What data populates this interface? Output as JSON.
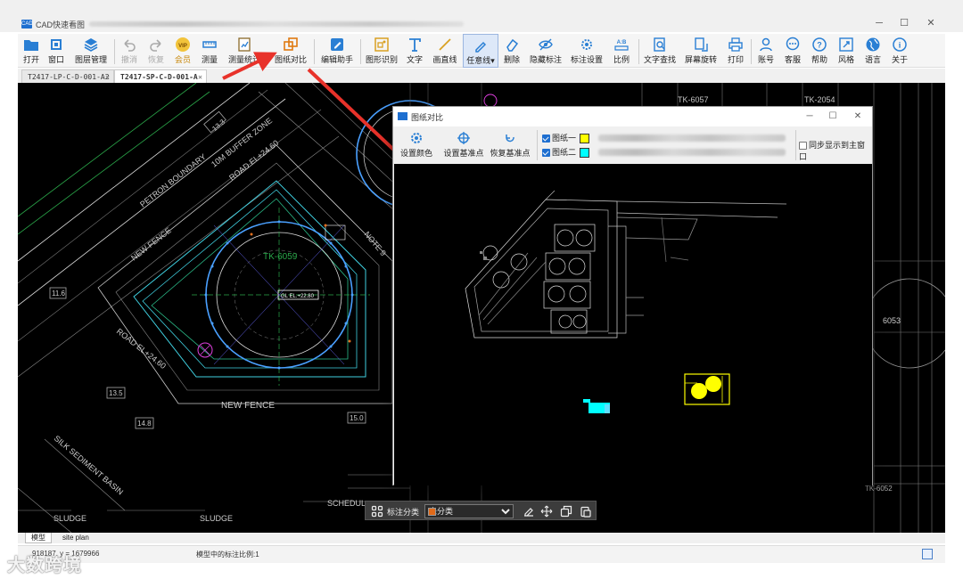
{
  "window": {
    "app_title": "CAD快速看图",
    "icon_text": "CAD",
    "minimize": "─",
    "maximize": "☐",
    "close": "✕"
  },
  "toolbar": [
    {
      "label": "打开",
      "icon": "open-folder-icon",
      "color": "#2a7fd4"
    },
    {
      "label": "窗口",
      "icon": "window-icon",
      "color": "#2a7fd4"
    },
    {
      "label": "图层管理",
      "icon": "layers-icon",
      "color": "#2a7fd4"
    },
    {
      "label": "撤消",
      "icon": "undo-icon",
      "disabled": true
    },
    {
      "label": "恢复",
      "icon": "redo-icon",
      "disabled": true
    },
    {
      "label": "会员",
      "icon": "vip-icon",
      "color": "#d9a021"
    },
    {
      "label": "测量",
      "icon": "measure-icon",
      "color": "#2a7fd4"
    },
    {
      "label": "测量统计",
      "icon": "measure-stats-icon",
      "color": "#8a6a2a"
    },
    {
      "label": "图纸对比",
      "icon": "drawing-compare-icon",
      "color": "#e07a10"
    },
    {
      "label": "编辑助手",
      "icon": "edit-assistant-icon",
      "color": "#2a7fd4"
    },
    {
      "label": "图形识别",
      "icon": "shape-recognition-icon",
      "color": "#d9a021"
    },
    {
      "label": "文字",
      "icon": "text-icon",
      "color": "#2a7fd4"
    },
    {
      "label": "画直线",
      "icon": "draw-line-icon",
      "color": "#d9a021"
    },
    {
      "label": "任意线",
      "icon": "freehand-line-icon",
      "color": "#2a7fd4"
    },
    {
      "label": "删除",
      "icon": "eraser-icon",
      "color": "#2a7fd4"
    },
    {
      "label": "隐藏标注",
      "icon": "hide-annotation-icon",
      "color": "#2a7fd4"
    },
    {
      "label": "标注设置",
      "icon": "annotation-settings-icon",
      "color": "#2a7fd4"
    },
    {
      "label": "比例",
      "icon": "scale-icon",
      "color": "#2a7fd4"
    },
    {
      "label": "文字查找",
      "icon": "text-search-icon",
      "color": "#2a7fd4"
    },
    {
      "label": "屏幕旋转",
      "icon": "screen-rotate-icon",
      "color": "#2a7fd4"
    },
    {
      "label": "打印",
      "icon": "print-icon",
      "color": "#2a7fd4"
    },
    {
      "label": "账号",
      "icon": "account-icon",
      "color": "#2a7fd4"
    },
    {
      "label": "客服",
      "icon": "customer-service-icon",
      "color": "#2a7fd4"
    },
    {
      "label": "帮助",
      "icon": "help-icon",
      "color": "#2a7fd4"
    },
    {
      "label": "风格",
      "icon": "style-icon",
      "color": "#2a7fd4"
    },
    {
      "label": "语言",
      "icon": "language-icon",
      "color": "#2a7fd4"
    },
    {
      "label": "关于",
      "icon": "about-icon",
      "color": "#2a7fd4"
    }
  ],
  "doc_tabs": [
    {
      "label": "T2417-LP-C-D-001-A2",
      "active": false
    },
    {
      "label": "T2417-SP-C-D-001-A",
      "active": true
    }
  ],
  "cad_labels": {
    "tk6059": "TK-6059",
    "tk6057": "TK-6057",
    "tk2054": "TK-2054",
    "tk6052": "TK-6052",
    "tk6053": "6053",
    "new_fence": "NEW FENCE",
    "new_fence2": "NEW FENCE",
    "petron": "PETRON BOUNDARY",
    "buffer": "10M BUFFER ZONE",
    "road1": "ROAD EL+24.60",
    "road2": "ROAD EL+24.60",
    "silk": "SILK SEDIMENT BASIN",
    "sludge1": "SLUDGE",
    "sludge2": "SLUDGE",
    "schedule": "SCHEDUL",
    "gl": "GL EL.+22.80",
    "note": "NOTE 9",
    "v1": "13.5",
    "v2": "14.8",
    "v3": "11.6",
    "v4": "13.3",
    "v5": "15.0"
  },
  "layout_tabs": [
    {
      "label": "模型",
      "active": true
    },
    {
      "label": "site plan",
      "active": false
    }
  ],
  "status": {
    "coords": "918187, y = 1679966",
    "scale_text": "模型中的标注比例:1"
  },
  "watermark": "大数跨境",
  "dialog": {
    "title": "图纸对比",
    "tools": [
      {
        "label": "设置颜色",
        "icon": "set-color-icon"
      },
      {
        "label": "设置基准点",
        "icon": "set-base-point-icon"
      },
      {
        "label": "恢复基准点",
        "icon": "restore-base-point-icon"
      }
    ],
    "drawing1": {
      "label": "图纸一",
      "color": "#ffff00"
    },
    "drawing2": {
      "label": "图纸二",
      "color": "#00ffff"
    },
    "sync_label": "同步显示到主窗口"
  },
  "float_bar": {
    "category_label": "标注分类",
    "category_value": "未分类"
  }
}
